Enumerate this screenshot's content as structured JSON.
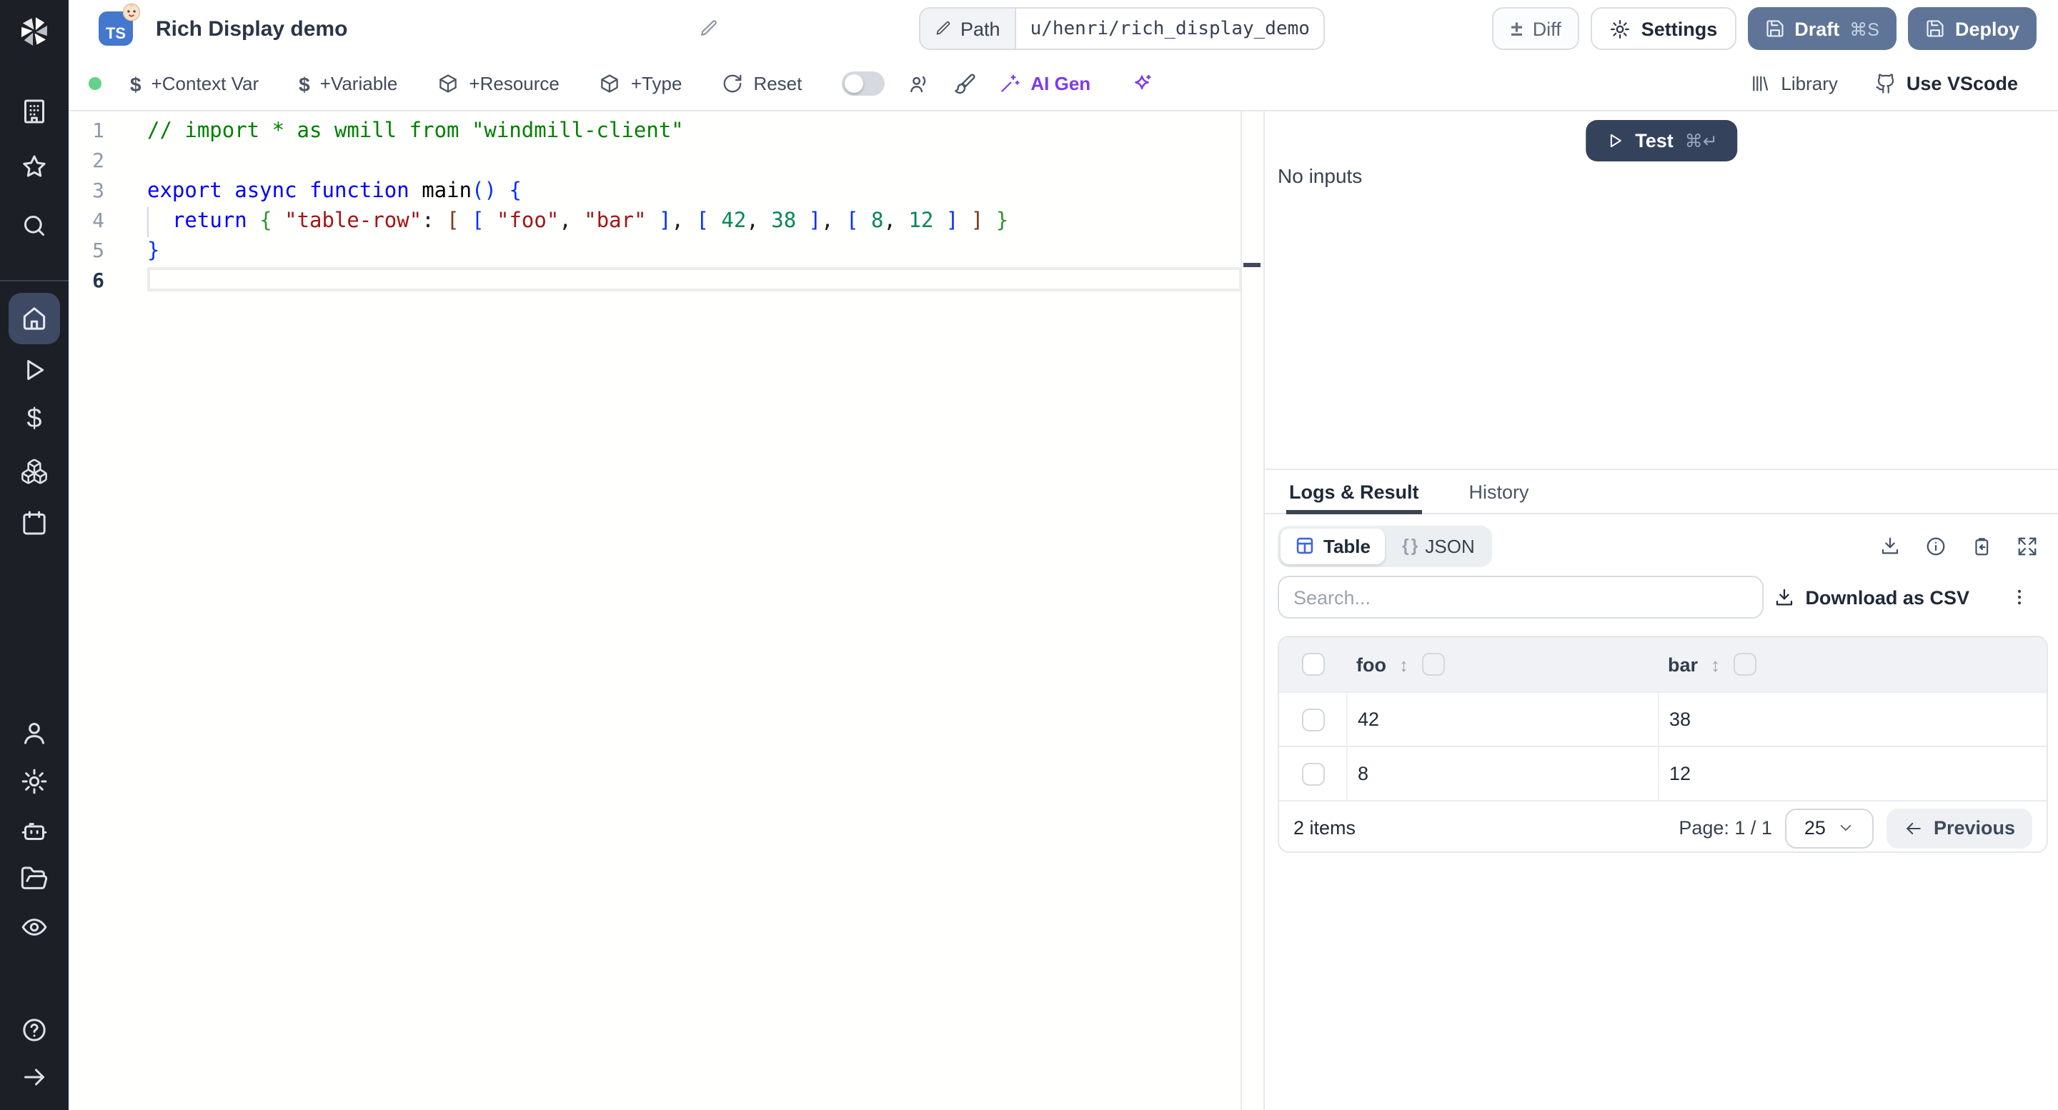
{
  "colors": {
    "sidebar_bg": "#1c1f26",
    "sidebar_active_bg": "#3e4a63",
    "primary_button": "#5f7597",
    "test_button": "#35425b",
    "ai_purple": "#7c3aed",
    "status_green": "#65d089",
    "ts_badge_blue": "#4477ce",
    "table_icon_blue": "#3f63f0"
  },
  "sidebar": {
    "icons": [
      "windmill-logo",
      "workspace-building",
      "favorites-star",
      "search",
      "home",
      "runs-play",
      "variables-dollar",
      "resources-boxes",
      "schedules-calendar",
      "user",
      "settings",
      "ai-robot",
      "folders",
      "audit-eye",
      "help",
      "collapse-arrow"
    ]
  },
  "header": {
    "language_badge": "TS",
    "title": "Rich Display demo",
    "path_button": "Path",
    "path_value": "u/henri/rich_display_demo",
    "diff": "Diff",
    "settings": "Settings",
    "draft": "Draft",
    "draft_shortcut": "⌘S",
    "deploy": "Deploy"
  },
  "toolbar": {
    "context_var": "+Context Var",
    "variable": "+Variable",
    "resource": "+Resource",
    "type": "+Type",
    "reset": "Reset",
    "ai_gen": "AI Gen",
    "library": "Library",
    "use_vscode": "Use VScode",
    "dollar_glyph": "$"
  },
  "editor": {
    "line_numbers": [
      "1",
      "2",
      "3",
      "4",
      "5",
      "6"
    ],
    "lines": [
      [
        {
          "t": "// import * as wmill from \"windmill-client\"",
          "c": "cm"
        }
      ],
      [],
      [
        {
          "t": "export",
          "c": "kw"
        },
        {
          "t": " ",
          "c": "pl"
        },
        {
          "t": "async",
          "c": "kw"
        },
        {
          "t": " ",
          "c": "pl"
        },
        {
          "t": "function",
          "c": "kw"
        },
        {
          "t": " ",
          "c": "pl"
        },
        {
          "t": "main",
          "c": "fn"
        },
        {
          "t": "(",
          "c": "b1"
        },
        {
          "t": ")",
          "c": "b1"
        },
        {
          "t": " ",
          "c": "pl"
        },
        {
          "t": "{",
          "c": "b1"
        }
      ],
      [
        {
          "t": "  ",
          "c": "pl"
        },
        {
          "t": "return",
          "c": "kw"
        },
        {
          "t": " ",
          "c": "pl"
        },
        {
          "t": "{",
          "c": "b2"
        },
        {
          "t": " ",
          "c": "pl"
        },
        {
          "t": "\"table-row\"",
          "c": "st"
        },
        {
          "t": ": ",
          "c": "pl"
        },
        {
          "t": "[",
          "c": "b3"
        },
        {
          "t": " ",
          "c": "pl"
        },
        {
          "t": "[",
          "c": "b1"
        },
        {
          "t": " ",
          "c": "pl"
        },
        {
          "t": "\"foo\"",
          "c": "st"
        },
        {
          "t": ", ",
          "c": "pl"
        },
        {
          "t": "\"bar\"",
          "c": "st"
        },
        {
          "t": " ",
          "c": "pl"
        },
        {
          "t": "]",
          "c": "b1"
        },
        {
          "t": ", ",
          "c": "pl"
        },
        {
          "t": "[",
          "c": "b1"
        },
        {
          "t": " ",
          "c": "pl"
        },
        {
          "t": "42",
          "c": "nm"
        },
        {
          "t": ", ",
          "c": "pl"
        },
        {
          "t": "38",
          "c": "nm"
        },
        {
          "t": " ",
          "c": "pl"
        },
        {
          "t": "]",
          "c": "b1"
        },
        {
          "t": ", ",
          "c": "pl"
        },
        {
          "t": "[",
          "c": "b1"
        },
        {
          "t": " ",
          "c": "pl"
        },
        {
          "t": "8",
          "c": "nm"
        },
        {
          "t": ", ",
          "c": "pl"
        },
        {
          "t": "12",
          "c": "nm"
        },
        {
          "t": " ",
          "c": "pl"
        },
        {
          "t": "]",
          "c": "b1"
        },
        {
          "t": " ",
          "c": "pl"
        },
        {
          "t": "]",
          "c": "b3"
        },
        {
          "t": " ",
          "c": "pl"
        },
        {
          "t": "}",
          "c": "b2"
        }
      ],
      [
        {
          "t": "}",
          "c": "b1"
        }
      ],
      []
    ]
  },
  "right_panel": {
    "test": {
      "label": "Test",
      "shortcut": "⌘↵"
    },
    "no_inputs": "No inputs",
    "tabs": {
      "logs": "Logs & Result",
      "history": "History"
    },
    "view": {
      "table": "Table",
      "json": "JSON",
      "braces": "{ }"
    },
    "search_placeholder": "Search...",
    "download_csv": "Download as CSV",
    "table": {
      "columns": [
        "foo",
        "bar"
      ],
      "sort_glyph": "↕",
      "rows": [
        [
          "42",
          "38"
        ],
        [
          "8",
          "12"
        ]
      ],
      "items_count": "2 items",
      "page_label": "Page: 1 / 1",
      "page_size": "25",
      "previous": "Previous"
    }
  }
}
